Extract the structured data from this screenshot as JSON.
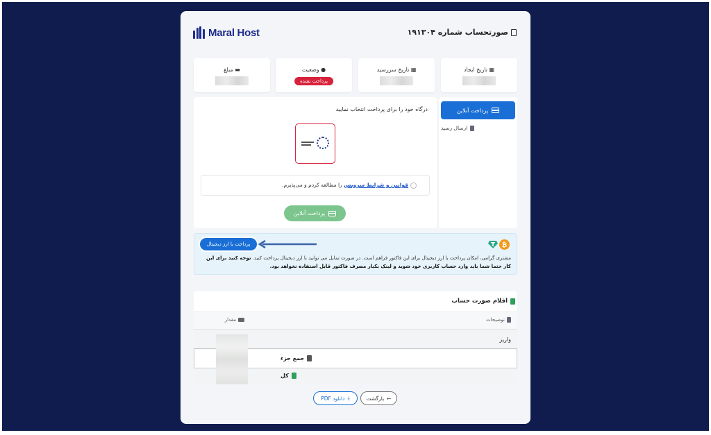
{
  "header": {
    "invoice_title": "صورتحساب شماره ۱۹۱۳۰۴",
    "logo_text": "Maral Host"
  },
  "info_boxes": {
    "created_label": "تاریخ ایجاد",
    "due_label": "تاریخ سررسید",
    "status_label": "وضعیت",
    "status_badge": "پرداخت نشده",
    "amount_label": "مبلغ"
  },
  "sidebar": {
    "tab_online": "پرداخت آنلاین",
    "tab_receipt": "ارسال رسید"
  },
  "payment": {
    "title": "درگاه خود را برای پرداخت انتخاب نمایید",
    "terms_link": "قوانین و شرایط سرویس",
    "terms_rest": " را مطالعه کردم و می‌پذیرم.",
    "pay_button": "پرداخت آنلاین"
  },
  "crypto": {
    "button": "پرداخت با ارز دیجیتال",
    "text_normal": "مشتری گرامی، امکان پرداخت با ارز دیجیتال برای این فاکتور فراهم است. در صورت تمایل می توانید با ارز دیجیتال پرداخت کنید. ",
    "text_bold": "توجه کنید برای این کار حتما شما باید وارد حساب کاربری خود شوید و لینک یکبار مصرف فاکتور قابل استفاده نخواهد بود."
  },
  "items": {
    "title": "اقلام صورت حساب",
    "col_description": "توضیحات",
    "col_amount": "مقدار",
    "row_deposit": "واریز",
    "row_subtotal": "جمع جزء",
    "row_total": "کل"
  },
  "footer": {
    "back_button": "بازگشت",
    "pdf_button": "دانلود PDF"
  },
  "colors": {
    "backdrop": "#0f1c4d",
    "primary": "#1a6fd6",
    "danger": "#d8213b",
    "success": "#7cc58e"
  }
}
